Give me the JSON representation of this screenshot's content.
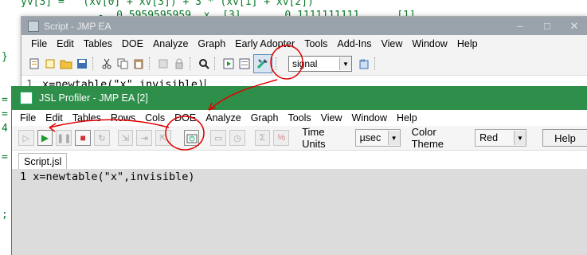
{
  "background": {
    "code_top": "yv[3] =   (xv[0] + xv[3]) + 3 * (xv[1] + xv[2])",
    "code_line2": "        -  0.5959595959  x  [3]  ...  0.1111111111 ...  [1]",
    "glyphs": [
      "}",
      "=",
      "=",
      "4",
      "=",
      ";"
    ]
  },
  "script_window": {
    "title": "Script - JMP EA",
    "controls": [
      "–",
      "□",
      "✕"
    ],
    "menu": [
      "File",
      "Edit",
      "Tables",
      "DOE",
      "Analyze",
      "Graph",
      "Early Adopter",
      "Tools",
      "Add-Ins",
      "View",
      "Window",
      "Help"
    ],
    "toolbar_icons": [
      "new-script-icon",
      "open-icon",
      "folder-icon",
      "save-icon",
      "cut-icon",
      "copy-icon",
      "paste-icon",
      "undo-icon",
      "lock-icon",
      "search-icon",
      "run-script-icon",
      "run-selection-icon",
      "debug-script-icon"
    ],
    "namespace_select": "signal",
    "line_number": "1",
    "code": "x=newtable(\"x\",invisible)"
  },
  "profiler_window": {
    "title": "JSL Profiler - JMP EA [2]",
    "menu": [
      "File",
      "Edit",
      "Tables",
      "Rows",
      "Cols",
      "DOE",
      "Analyze",
      "Graph",
      "Tools",
      "View",
      "Window",
      "Help"
    ],
    "time_units_label": "Time Units",
    "time_units_value": "µsec",
    "color_theme_label": "Color Theme",
    "color_theme_value": "Red",
    "help_label": "Help",
    "tab_label": "Script.jsl",
    "line_number": "1",
    "code": "x=newtable(\"x\",invisible)"
  },
  "colors": {
    "profiler_title": "#2e8f4a",
    "script_title": "#9aa3ab",
    "annotation": "#e00000"
  }
}
